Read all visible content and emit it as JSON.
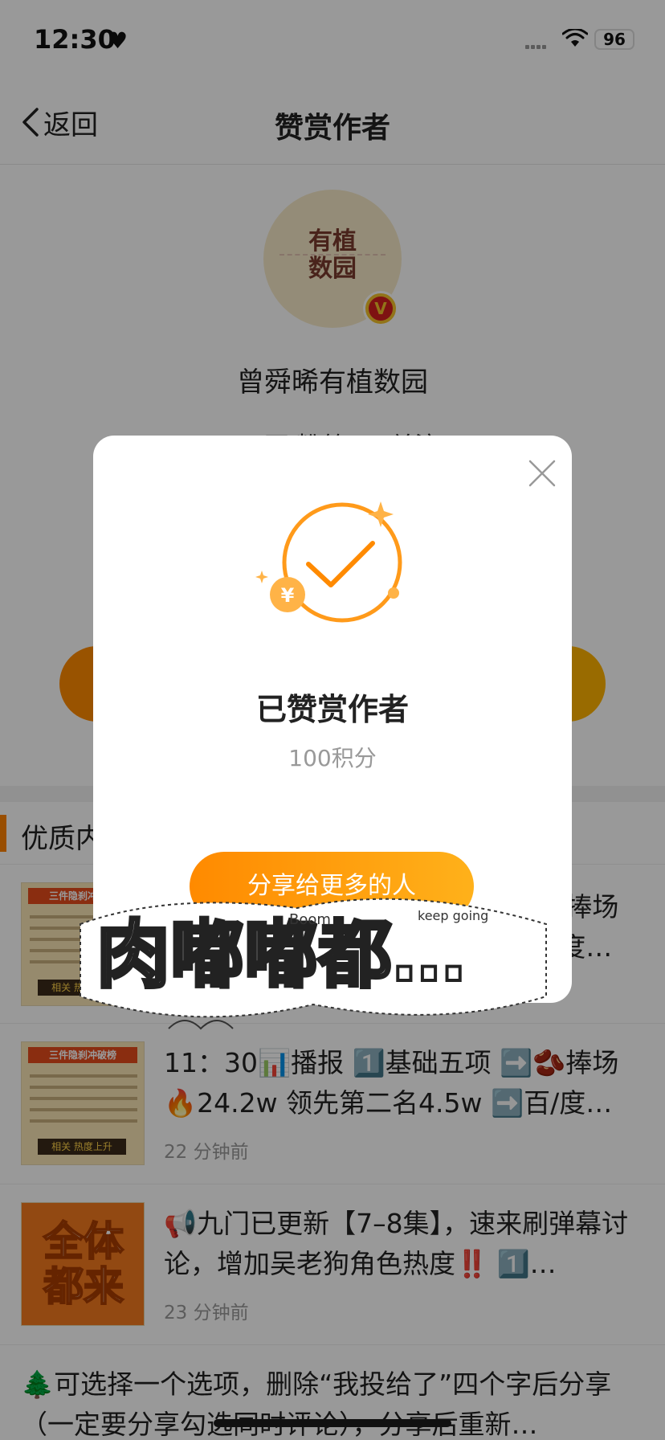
{
  "status_bar": {
    "time": "12:30",
    "battery": "96"
  },
  "nav": {
    "back_label": "返回",
    "title": "赞赏作者"
  },
  "profile": {
    "avatar_text_1": "有植",
    "avatar_text_2": "数园",
    "verified_mark": "V",
    "name": "曾舜晞有植数园",
    "stats_partial": "2.2万 粉丝   32 关注"
  },
  "section": {
    "title": "优质内"
  },
  "feed": [
    {
      "text": "11：30📊播报 1️⃣基础五项 ➡️🫘捧场 🔥24.2w 领先第二名4.5w ➡️百/度…",
      "time": "",
      "thumb_title": "三件隐刹冲破榜",
      "thumb_bottom": "相关 热度上升"
    },
    {
      "text": "11：30📊播报 1️⃣基础五项 ➡️🫘捧场 🔥24.2w 领先第二名4.5w ➡️百/度…",
      "time": "22 分钟前",
      "thumb_title": "三件隐刹冲破榜",
      "thumb_bottom": "相关 热度上升"
    },
    {
      "text": "📢九门已更新【7–8集】，速来刷弹幕讨论，增加吴老狗角色热度‼️ 1️⃣…",
      "time": "23 分钟前",
      "thumb_title": "全体都来"
    },
    {
      "text": "🌲可选择一个选项，删除“我投给了”四个字后分享（一定要分享勾选同时评论），分享后重新…"
    }
  ],
  "modal": {
    "title": "已赞赏作者",
    "points": "100积分",
    "share_label": "分享给更多的人",
    "currency_symbol": "¥"
  },
  "sticker": {
    "text": "肉嘟嘟都…",
    "small_1": "Boom",
    "small_2": "keep going"
  },
  "colors": {
    "accent": "#ff8a00",
    "overlay": "rgba(0,0,0,0.4)"
  }
}
